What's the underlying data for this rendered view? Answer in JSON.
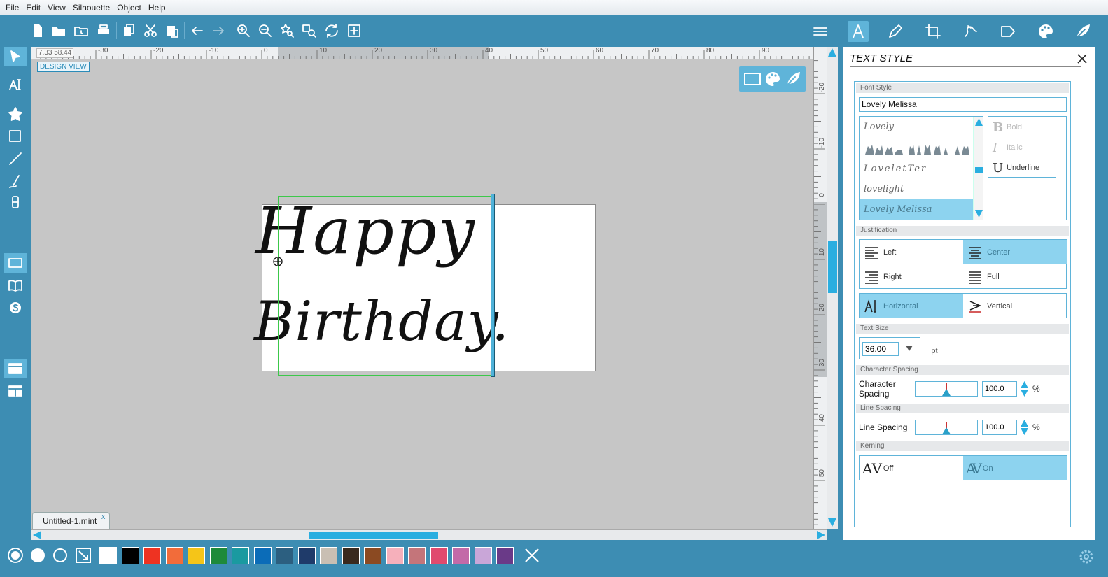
{
  "menu": [
    "File",
    "Edit",
    "View",
    "Silhouette",
    "Object",
    "Help"
  ],
  "ruler": {
    "coords": "7.33  58.44",
    "h_ticks": [
      "-30",
      "-20",
      "-10",
      "0",
      "10",
      "20",
      "30",
      "40",
      "50",
      "60",
      "70",
      "80",
      "90"
    ],
    "v_ticks": [
      "-20",
      "-10",
      "0",
      "10",
      "20",
      "30",
      "40",
      "50"
    ]
  },
  "canvas": {
    "design_view_label": "DESIGN VIEW",
    "text_line1": "Happy",
    "text_line2": "Birthday."
  },
  "document_tab": {
    "name": "Untitled-1.mint",
    "close": "x"
  },
  "panel": {
    "title": "TEXT STYLE",
    "font_style_section": "Font Style",
    "font_value": "Lovely Melissa",
    "font_list": [
      "Lovely",
      "silhouettes-font",
      "LoveletTer",
      "lovelight",
      "Lovely Melissa"
    ],
    "selected_font_index": 4,
    "style_options": [
      {
        "glyph": "B",
        "label": "Bold",
        "enabled": false
      },
      {
        "glyph": "I",
        "label": "Italic",
        "enabled": false
      },
      {
        "glyph": "U",
        "label": "Underline",
        "enabled": true
      }
    ],
    "justification_section": "Justification",
    "justification": [
      {
        "label": "Left",
        "active": false
      },
      {
        "label": "Center",
        "active": true
      },
      {
        "label": "Right",
        "active": false
      },
      {
        "label": "Full",
        "active": false
      }
    ],
    "orientation": [
      {
        "label": "Horizontal",
        "active": true
      },
      {
        "label": "Vertical",
        "active": false
      }
    ],
    "text_size_section": "Text Size",
    "text_size_value": "36.00",
    "text_size_unit": "pt",
    "char_spacing_section": "Character Spacing",
    "char_spacing_label_1": "Character",
    "char_spacing_label_2": "Spacing",
    "char_spacing_value": "100.0",
    "char_spacing_level_percent": 100,
    "line_spacing_section": "Line Spacing",
    "line_spacing_label": "Line Spacing",
    "line_spacing_value": "100.0",
    "line_spacing_level_percent": 100,
    "percent_sign": "%",
    "kerning_section": "Kerning",
    "kerning": [
      {
        "glyph": "AV",
        "label": "Off",
        "active": false
      },
      {
        "glyph": "AV",
        "label": "On",
        "active": true
      }
    ]
  },
  "colors": {
    "accent": "#3d8db3",
    "highlight": "#8dd3ef",
    "scroll": "#2aaee0",
    "swatches": [
      "#ffffff",
      "#000000",
      "#ee3322",
      "#f26c3a",
      "#f5c518",
      "#1e8a3a",
      "#1a9aa0",
      "#0b6cb8",
      "#2c5f80",
      "#1f3b6a",
      "#c9bfb3",
      "#3a2a1e",
      "#8b4a22",
      "#f6b0bb",
      "#c4757a",
      "#e04a6e",
      "#c36aa8",
      "#c9a6d8",
      "#6a3a88"
    ]
  }
}
